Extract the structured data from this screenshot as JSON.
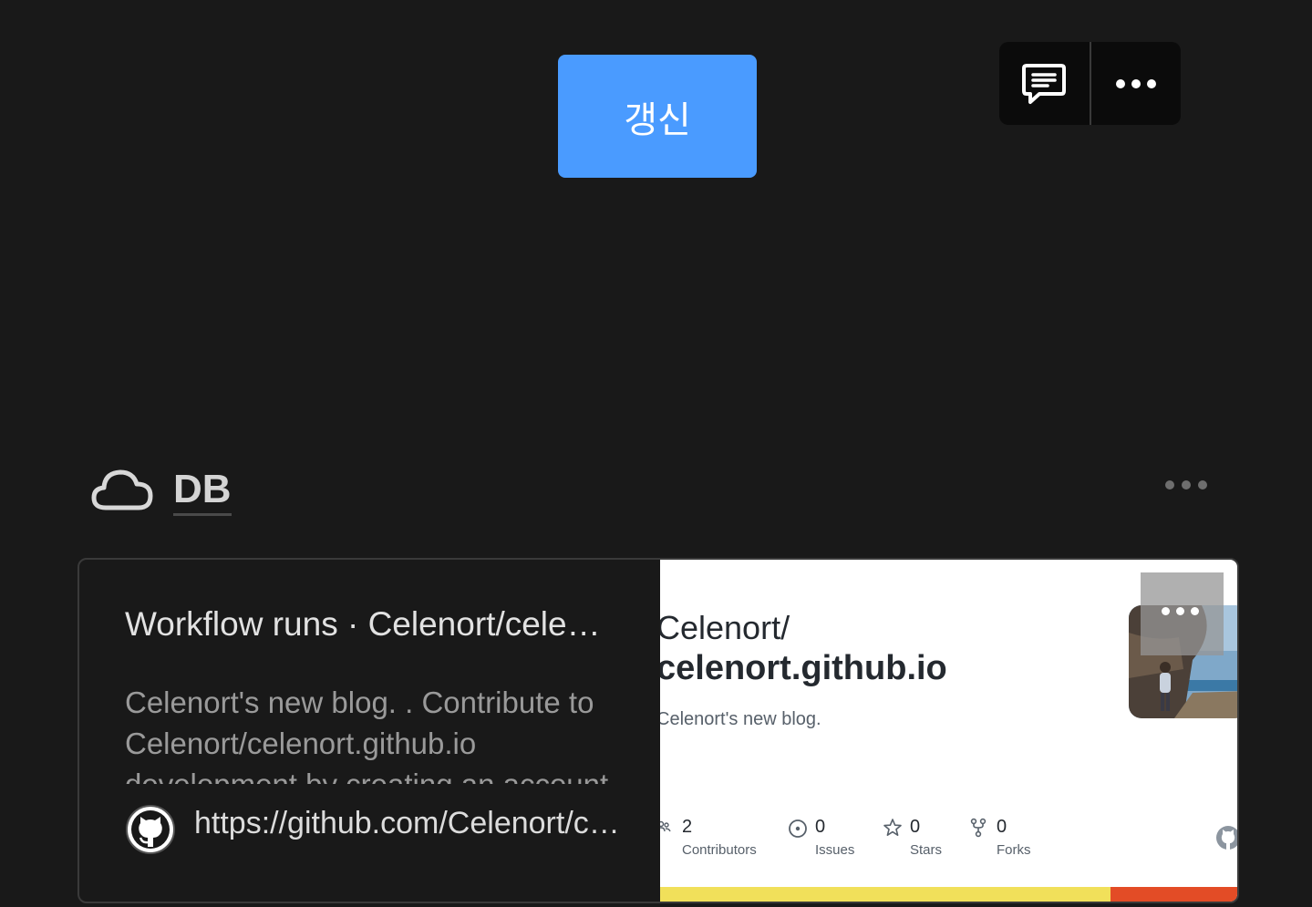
{
  "toolbar": {
    "refresh_label": "갱신"
  },
  "section": {
    "title": "DB",
    "icon": "cloud-icon"
  },
  "card": {
    "title": "Workflow runs · Celenort/celenort.github.io",
    "description": "Celenort's new blog. . Contribute to Celenort/celenort.github.io development by creating an account on GitHub.",
    "url": "https://github.com/Celenort/celenort.github.io/actions",
    "preview": {
      "owner": "Celenort/",
      "repo": "celenort.github.io",
      "description": "Celenort's new blog.",
      "stats": [
        {
          "value": "2",
          "label": "Contributors",
          "icon": "contributors-icon"
        },
        {
          "value": "0",
          "label": "Issues",
          "icon": "issues-icon"
        },
        {
          "value": "0",
          "label": "Stars",
          "icon": "star-icon"
        },
        {
          "value": "0",
          "label": "Forks",
          "icon": "fork-icon"
        }
      ],
      "language_colors": [
        "#f1e05a",
        "#e34c26"
      ],
      "language_shares": [
        0.78,
        0.22
      ]
    }
  },
  "colors": {
    "background": "#191919",
    "accent": "#4a9bff"
  }
}
